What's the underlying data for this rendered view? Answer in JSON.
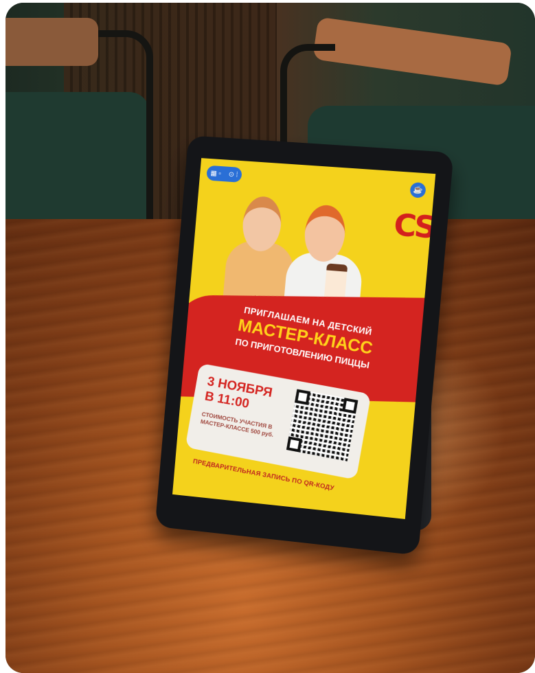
{
  "photo": {
    "subject": "tablet-advert-on-table"
  },
  "screen": {
    "status_icons": [
      "▦ ▫",
      "⊙ ⁞"
    ],
    "brand_mark": "CS",
    "cup_icon": "☕",
    "headline_top": "ПРИГЛАШАЕМ НА ДЕТСКИЙ",
    "headline_main": "МАСТЕР-КЛАСС",
    "headline_sub": "ПО ПРИГОТОВЛЕНИЮ ПИЦЦЫ",
    "date_line1": "3 НОЯБРЯ",
    "date_line2": "В 11:00",
    "price_text": "СТОИМОСТЬ УЧАСТИЯ В МАСТЕР-КЛАССЕ 500 руб.",
    "footer": "ПРЕДВАРИТЕЛЬНАЯ ЗАПИСЬ ПО QR-КОДУ",
    "colors": {
      "yellow": "#f4d21c",
      "red": "#d42420",
      "blue": "#2a6fd6"
    }
  }
}
